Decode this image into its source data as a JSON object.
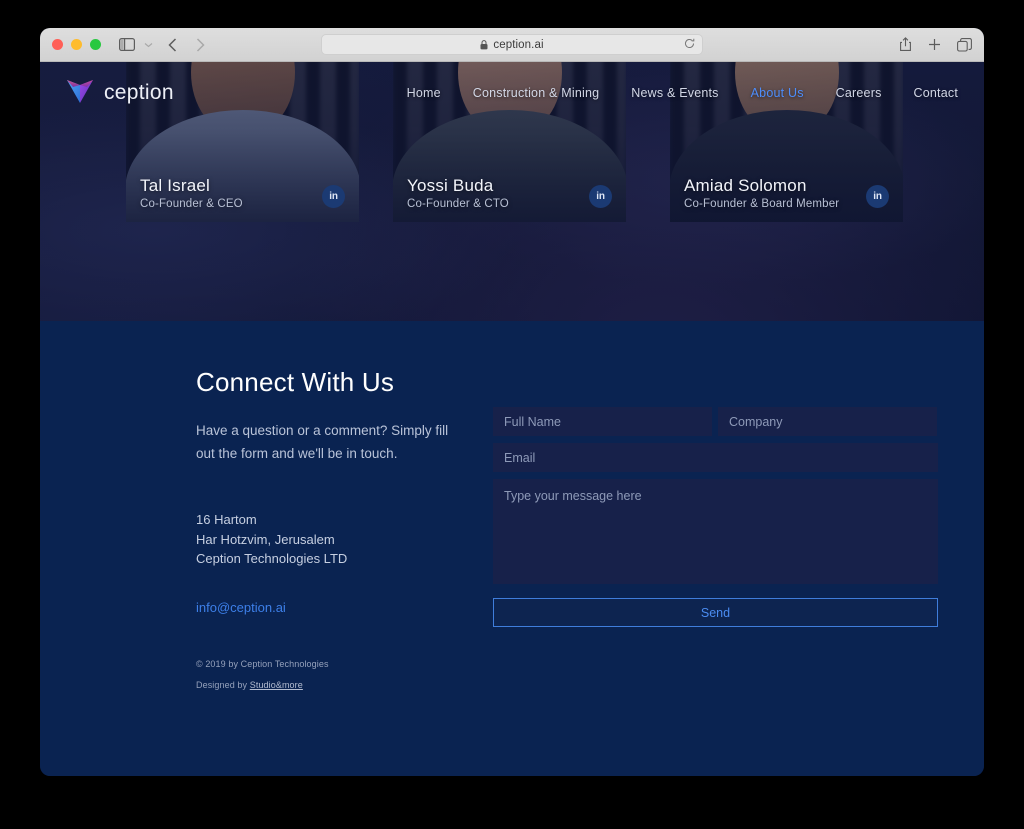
{
  "browser": {
    "url": "ception.ai",
    "lock_icon": "lock-icon",
    "reload_icon": "reload-icon",
    "sidebar_icon": "sidebar-toggle-icon",
    "chevron_icon": "chevron-down-icon",
    "back_icon": "back-arrow-icon",
    "forward_icon": "forward-arrow-icon",
    "share_icon": "share-icon",
    "newtab_icon": "plus-icon",
    "tabs_icon": "tab-overview-icon"
  },
  "site": {
    "logo_text": "ception",
    "logo_mark": "ception-v-logo",
    "nav": [
      {
        "label": "Home",
        "active": false
      },
      {
        "label": "Construction & Mining",
        "active": false
      },
      {
        "label": "News & Events",
        "active": false
      },
      {
        "label": "About Us",
        "active": true
      },
      {
        "label": "Careers",
        "active": false
      },
      {
        "label": "Contact",
        "active": false
      }
    ]
  },
  "team": [
    {
      "name": "Tal Israel",
      "role": "Co-Founder & CEO",
      "social": "in"
    },
    {
      "name": "Yossi Buda",
      "role": "Co-Founder & CTO",
      "social": "in"
    },
    {
      "name": "Amiad Solomon",
      "role": "Co-Founder & Board Member",
      "social": "in"
    }
  ],
  "contact": {
    "heading": "Connect With Us",
    "lead": "Have a question or a comment? Simply fill out the form and we'll be in touch.",
    "address_line1": "16 Hartom",
    "address_line2": "Har Hotzvim, Jerusalem",
    "address_line3": "Ception Technologies LTD",
    "email": "info@ception.ai",
    "form": {
      "fullname_placeholder": "Full Name",
      "fullname_value": "",
      "company_placeholder": "Company",
      "company_value": "",
      "email_placeholder": "Email",
      "email_value": "",
      "message_placeholder": "Type your message here",
      "message_value": "",
      "send_label": "Send"
    }
  },
  "footer": {
    "copyright": "© 2019 by Ception Technologies",
    "designed_prefix": "Designed by ",
    "designed_by": "Studio&more"
  },
  "colors": {
    "accent_blue": "#4a8bf0",
    "hero_bg": "#121633",
    "contact_bg": "#0a2351",
    "field_bg": "#17214a"
  }
}
